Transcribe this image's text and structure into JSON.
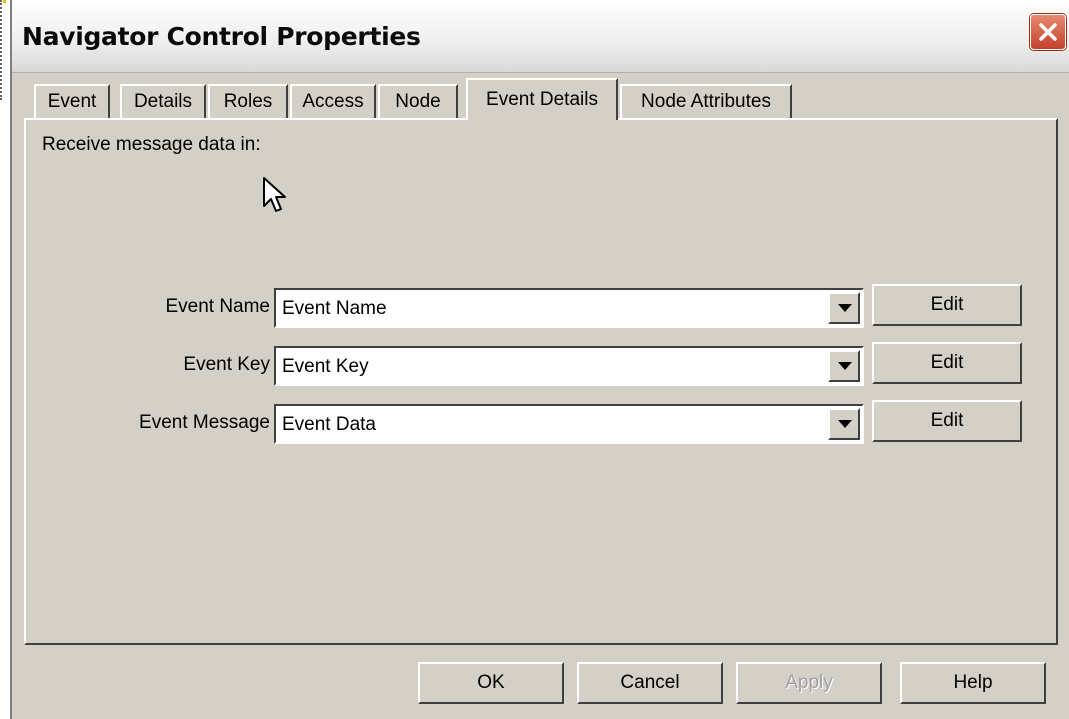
{
  "window": {
    "title": "Navigator Control Properties"
  },
  "tabs": [
    {
      "label": "Event"
    },
    {
      "label": "Details"
    },
    {
      "label": "Roles"
    },
    {
      "label": "Access"
    },
    {
      "label": "Node"
    },
    {
      "label": "Event Details"
    },
    {
      "label": "Node Attributes"
    }
  ],
  "active_tab": "Event Details",
  "panel": {
    "section_label": "Receive message data in:",
    "rows": [
      {
        "label": "Event Name",
        "value": "Event Name",
        "button": "Edit"
      },
      {
        "label": "Event Key",
        "value": "Event Key",
        "button": "Edit"
      },
      {
        "label": "Event Message",
        "value": "Event Data",
        "button": "Edit"
      }
    ]
  },
  "footer": {
    "ok": "OK",
    "cancel": "Cancel",
    "apply": "Apply",
    "help": "Help"
  },
  "icons": {
    "close": "close-icon",
    "dropdown": "chevron-down-icon",
    "cursor": "mouse-cursor-icon"
  },
  "colors": {
    "face": "#d4d0c8",
    "close_red": "#c4402a"
  }
}
